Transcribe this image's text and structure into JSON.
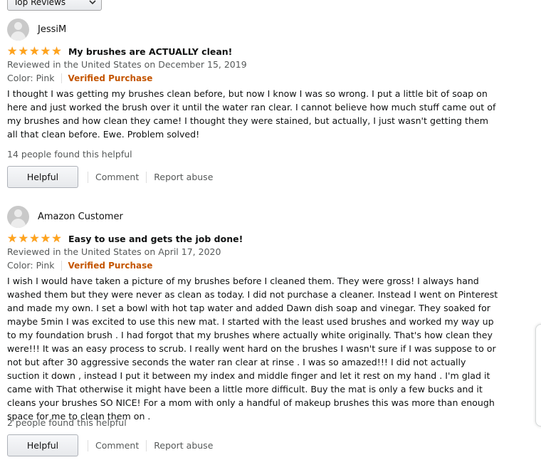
{
  "sort": {
    "selected": "Top Reviews",
    "chevron_icon": "chevron-down-icon"
  },
  "reviews": [
    {
      "author": "JessiM",
      "rating": 5,
      "title": "My brushes are ACTUALLY clean!",
      "date_line": "Reviewed in the United States on December 15, 2019",
      "color": "Color: Pink",
      "verified": "Verified Purchase",
      "body": "I thought I was getting my brushes clean before, but now I know I was so wrong. I put a little bit of soap on here and just worked the brush over it until the water ran clear. I cannot believe how much stuff came out of my brushes and how clean they came! I thought they were stained, but actually, I just wasn't getting them all that clean before. Ewe. Problem solved!",
      "helpful_count": "14 people found this helpful",
      "helpful_label": "Helpful",
      "comment_label": "Comment",
      "report_label": "Report abuse"
    },
    {
      "author": "Amazon Customer",
      "rating": 5,
      "title": "Easy to use and gets the job done!",
      "date_line": "Reviewed in the United States on April 17, 2020",
      "color": "Color: Pink",
      "verified": "Verified Purchase",
      "body": "I wish I would have taken a picture of my brushes before I cleaned them. They were gross! I always hand washed them but they were never as clean as today. I did not purchase a cleaner. Instead I went on Pinterest and made my own. I set a bowl with hot tap water and added Dawn dish soap and vinegar. They soaked for maybe 5min I was excited to use this new mat. I started with the least used brushes and worked my way up to my foundation brush . I had forgot that my brushes where actually white originally. That's how clean they were!!! It was an easy process to scrub. I really went hard on the brushes I wasn't sure if I was suppose to or not but after 30 aggressive seconds the water ran clear at rinse . I was so amazed!!! I did not actually suction it down , instead I put it between my index and middle finger and let it rest on my hand . I'm glad it came with That otherwise it might have been a little more difficult. Buy the mat is only a few bucks and it cleans your brushes SO NICE! For a mom with only a handful of makeup brushes this was more than enough space for me to clean them on .",
      "helpful_count": "2 people found this helpful",
      "helpful_label": "Helpful",
      "comment_label": "Comment",
      "report_label": "Report abuse"
    }
  ],
  "colors": {
    "star": "#ffa41c",
    "verified": "#c45500",
    "muted": "#565959"
  }
}
